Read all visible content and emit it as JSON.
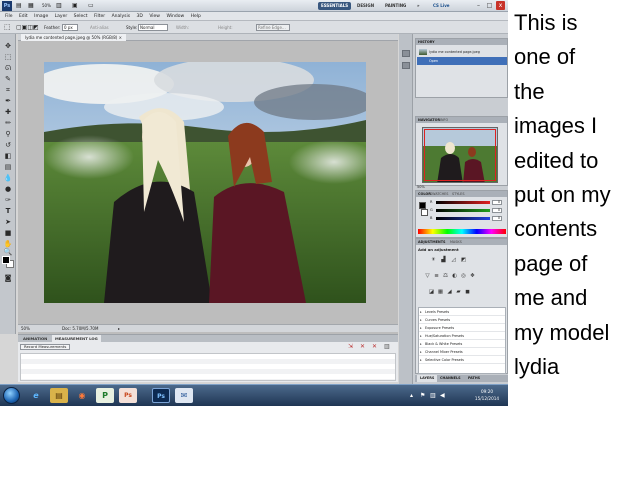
{
  "titlebar": {
    "zoom": "50%",
    "workspaces": [
      "ESSENTIALS",
      "DESIGN",
      "PAINTING"
    ],
    "more": "»",
    "cs_live": "CS Live",
    "controls": [
      "–",
      "□",
      "x"
    ]
  },
  "menu": [
    "File",
    "Edit",
    "Image",
    "Layer",
    "Select",
    "Filter",
    "Analysis",
    "3D",
    "View",
    "Window",
    "Help"
  ],
  "options": {
    "feather_label": "Feather:",
    "feather_value": "0 px",
    "antialias_label": "Anti-alias",
    "style_label": "Style:",
    "style_value": "Normal",
    "width_label": "Width:",
    "height_label": "Height:",
    "refine_label": "Refine Edge..."
  },
  "document": {
    "tab_title": "lydia me contented page.jpeg @ 50% (RGB/8)",
    "tab_close": "×",
    "status_zoom": "50%",
    "status_doc": "Doc: 5.70M/5.70M"
  },
  "bottom_panel": {
    "tabs": [
      "ANIMATION",
      "MEASUREMENT LOG"
    ],
    "record_button": "Record Measurements"
  },
  "history": {
    "title": "HISTORY",
    "rows": [
      "lydia me contented page.jpeg",
      "Open"
    ]
  },
  "navigator": {
    "tabs": [
      "NAVIGATOR",
      "INFO"
    ],
    "zoom": "50%"
  },
  "color_panel": {
    "tabs": [
      "COLOR",
      "SWATCHES",
      "STYLES"
    ],
    "channels": [
      {
        "label": "R",
        "value": "0",
        "color": "#e02020"
      },
      {
        "label": "G",
        "value": "0",
        "color": "#20a020"
      },
      {
        "label": "B",
        "value": "0",
        "color": "#2040e0"
      }
    ]
  },
  "adjustments": {
    "tabs": [
      "ADJUSTMENTS",
      "MASKS"
    ],
    "title": "Add an adjustment",
    "presets": [
      "Levels Presets",
      "Curves Presets",
      "Exposure Presets",
      "Hue/Saturation Presets",
      "Black & White Presets",
      "Channel Mixer Presets",
      "Selective Color Presets"
    ]
  },
  "dock_tabs": [
    "LAYERS",
    "CHANNELS",
    "PATHS"
  ],
  "taskbar": {
    "apps": [
      "e",
      "▤",
      "◉",
      "P",
      "Ps",
      "Ps",
      "✉"
    ],
    "time": "09:20",
    "date": "15/12/2014"
  },
  "caption": {
    "lines": [
      "This is",
      "one of",
      "the",
      "images I",
      "edited to",
      "put on my",
      "contents",
      "page of",
      "me and",
      "my model",
      "lydia"
    ]
  }
}
